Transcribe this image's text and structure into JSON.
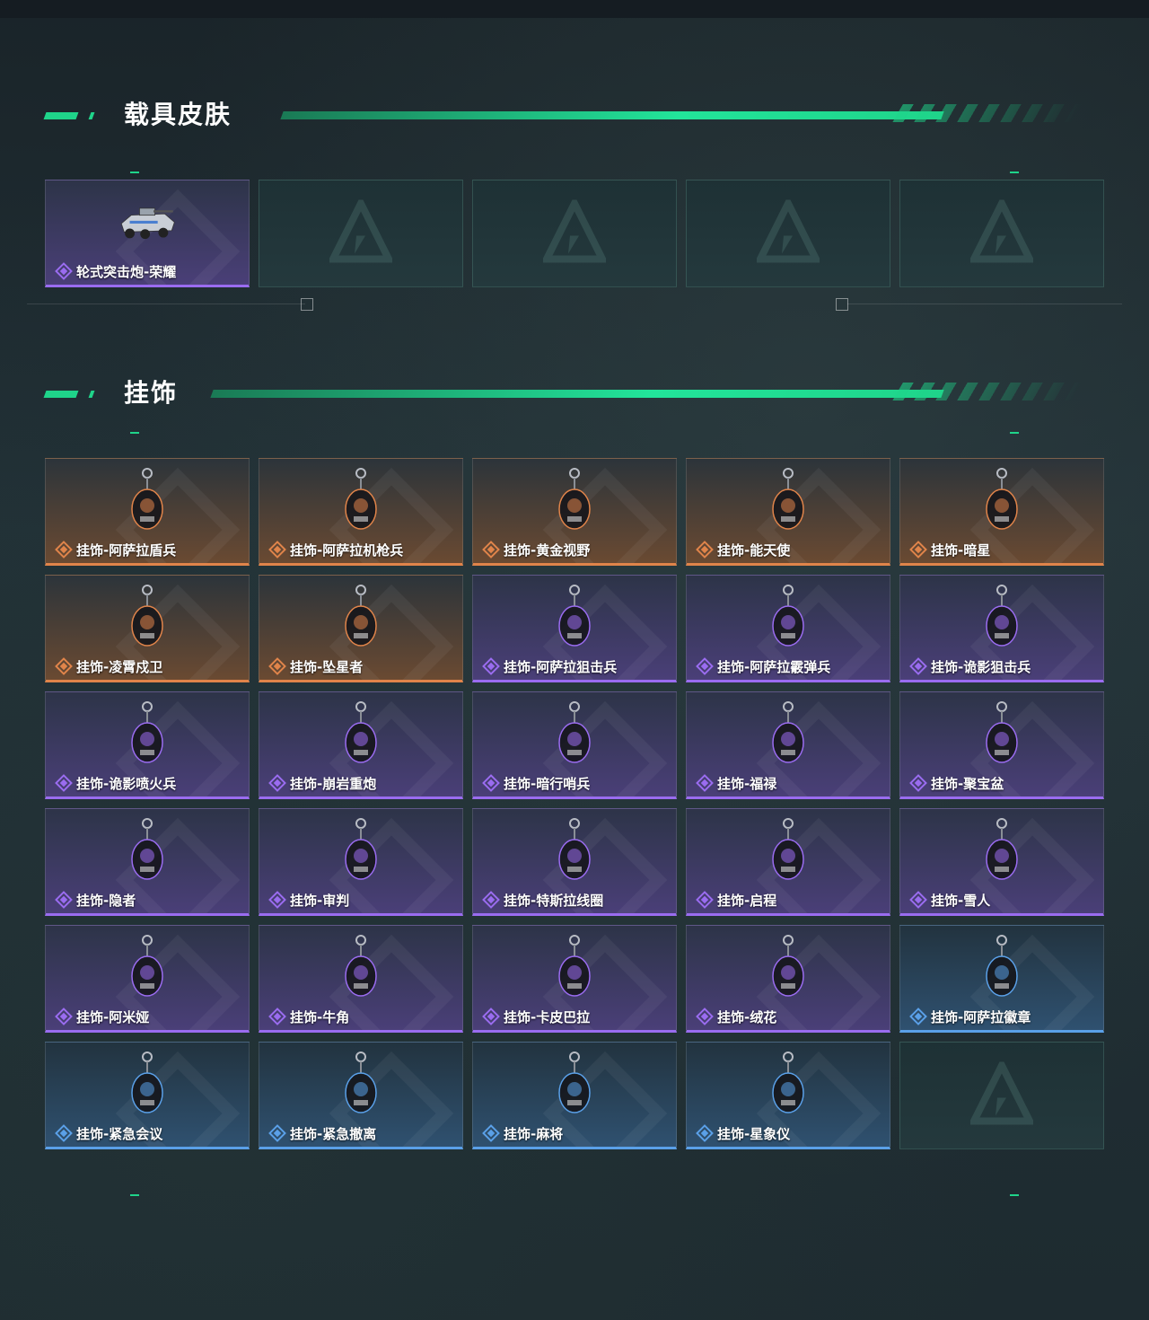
{
  "sections": [
    {
      "title": "载具皮肤",
      "items": [
        {
          "label": "轮式突击炮-荣耀",
          "rarity": "purple",
          "icon": "armored-vehicle-icon"
        },
        {
          "label": "",
          "rarity": "empty",
          "icon": "placeholder-logo-icon"
        },
        {
          "label": "",
          "rarity": "empty",
          "icon": "placeholder-logo-icon"
        },
        {
          "label": "",
          "rarity": "empty",
          "icon": "placeholder-logo-icon"
        },
        {
          "label": "",
          "rarity": "empty",
          "icon": "placeholder-logo-icon"
        }
      ]
    },
    {
      "title": "挂饰",
      "items": [
        {
          "label": "挂饰-阿萨拉盾兵",
          "rarity": "orange",
          "icon": "shield-soldier-charm-icon"
        },
        {
          "label": "挂饰-阿萨拉机枪兵",
          "rarity": "orange",
          "icon": "machinegunner-charm-icon"
        },
        {
          "label": "挂饰-黄金视野",
          "rarity": "orange",
          "icon": "golden-vision-charm-icon"
        },
        {
          "label": "挂饰-能天使",
          "rarity": "orange",
          "icon": "exusiai-charm-icon"
        },
        {
          "label": "挂饰-暗星",
          "rarity": "orange",
          "icon": "dark-star-charm-icon"
        },
        {
          "label": "挂饰-凌霄戍卫",
          "rarity": "orange",
          "icon": "sky-guard-charm-icon"
        },
        {
          "label": "挂饰-坠星者",
          "rarity": "orange",
          "icon": "star-faller-charm-icon"
        },
        {
          "label": "挂饰-阿萨拉狙击兵",
          "rarity": "purple",
          "icon": "sniper-charm-icon"
        },
        {
          "label": "挂饰-阿萨拉霰弹兵",
          "rarity": "purple",
          "icon": "shotgunner-charm-icon"
        },
        {
          "label": "挂饰-诡影狙击兵",
          "rarity": "purple",
          "icon": "shadow-sniper-charm-icon"
        },
        {
          "label": "挂饰-诡影喷火兵",
          "rarity": "purple",
          "icon": "flamethrower-charm-icon"
        },
        {
          "label": "挂饰-崩岩重炮",
          "rarity": "purple",
          "icon": "heavy-cannon-charm-icon"
        },
        {
          "label": "挂饰-暗行哨兵",
          "rarity": "purple",
          "icon": "sentinel-charm-icon"
        },
        {
          "label": "挂饰-福禄",
          "rarity": "purple",
          "icon": "gourd-charm-icon"
        },
        {
          "label": "挂饰-聚宝盆",
          "rarity": "purple",
          "icon": "treasure-bowl-charm-icon"
        },
        {
          "label": "挂饰-隐者",
          "rarity": "purple",
          "icon": "hermit-card-charm-icon"
        },
        {
          "label": "挂饰-审判",
          "rarity": "purple",
          "icon": "judgement-card-charm-icon"
        },
        {
          "label": "挂饰-特斯拉线圈",
          "rarity": "purple",
          "icon": "tesla-coil-charm-icon"
        },
        {
          "label": "挂饰-启程",
          "rarity": "purple",
          "icon": "departure-charm-icon"
        },
        {
          "label": "挂饰-雪人",
          "rarity": "purple",
          "icon": "snowman-charm-icon"
        },
        {
          "label": "挂饰-阿米娅",
          "rarity": "purple",
          "icon": "amiya-charm-icon"
        },
        {
          "label": "挂饰-牛角",
          "rarity": "purple",
          "icon": "bull-horn-charm-icon"
        },
        {
          "label": "挂饰-卡皮巴拉",
          "rarity": "purple",
          "icon": "capybara-charm-icon"
        },
        {
          "label": "挂饰-绒花",
          "rarity": "purple",
          "icon": "velvet-flower-charm-icon"
        },
        {
          "label": "挂饰-阿萨拉徽章",
          "rarity": "blue",
          "icon": "badge-charm-icon"
        },
        {
          "label": "挂饰-紧急会议",
          "rarity": "blue",
          "icon": "emergency-meeting-charm-icon"
        },
        {
          "label": "挂饰-紧急撤离",
          "rarity": "blue",
          "icon": "emergency-evac-charm-icon"
        },
        {
          "label": "挂饰-麻将",
          "rarity": "blue",
          "icon": "mahjong-charm-icon"
        },
        {
          "label": "挂饰-星象仪",
          "rarity": "blue",
          "icon": "astrolabe-charm-icon"
        },
        {
          "label": "",
          "rarity": "empty",
          "icon": "placeholder-logo-icon"
        }
      ]
    }
  ],
  "colors": {
    "accent": "#1fd48a",
    "purple": "#9a6cf0",
    "orange": "#e0844a",
    "blue": "#5aa0e8"
  }
}
